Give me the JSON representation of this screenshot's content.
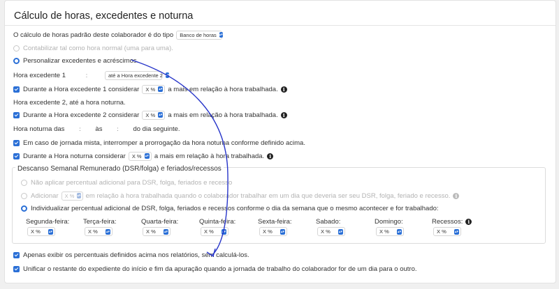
{
  "section": {
    "title": "Cálculo de horas, excedentes e noturna"
  },
  "standard": {
    "label": "O cálculo de horas padrão deste colaborador é do tipo",
    "select_value": "Banco de horas"
  },
  "options": {
    "normal_label": "Contabilizar tal como hora normal (uma para uma).",
    "custom_label": "Personalizar excedentes e acréscimos."
  },
  "he1": {
    "label": "Hora excedente 1",
    "time_value": ":",
    "range_value": "até a Hora excedente 2",
    "consider_prefix": "Durante a Hora excedente 1 considerar",
    "percent_value": "X %",
    "consider_suffix": "a mais em relação à hora trabalhada."
  },
  "he2": {
    "label": "Hora excedente 2, até a hora noturna.",
    "consider_prefix": "Durante a Hora excedente 2 considerar",
    "percent_value": "X %",
    "consider_suffix": "a mais em relação à hora trabalhada."
  },
  "night": {
    "label_from": "Hora noturna das",
    "from_value": ":",
    "label_to": "às",
    "to_value": ":",
    "label_next": "do dia seguinte.",
    "mixed_label": "Em caso de jornada mista, interromper a prorrogação da hora noturna conforme definido acima.",
    "consider_prefix": "Durante a Hora noturna considerar",
    "percent_value": "X %",
    "consider_suffix": "a mais em relação à hora trabalhada."
  },
  "dsr": {
    "legend": "Descanso Semanal Remunerado (DSR/folga) e feriados/recessos",
    "opt_none": "Não aplicar percentual adicional para DSR, folga, feriados e recesso",
    "opt_add_prefix": "Adicionar",
    "opt_add_value": "X %",
    "opt_add_suffix": "em relação à hora trabalhada quando o colaborador trabalhar em um dia que deveria ser seu DSR, folga, feriado e recesso.",
    "opt_individual": "Individualizar percentual adicional de DSR, folga, feriados e recessos conforme o dia da semana que o mesmo acontecer e for trabalhado:",
    "days": [
      {
        "label": "Segunda-feira:",
        "value": "X %"
      },
      {
        "label": "Terça-feira:",
        "value": "X %"
      },
      {
        "label": "Quarta-feira:",
        "value": "X %"
      },
      {
        "label": "Quinta-feira:",
        "value": "X %"
      },
      {
        "label": "Sexta-feira:",
        "value": "X %"
      },
      {
        "label": "Sabado:",
        "value": "X %"
      },
      {
        "label": "Domingo:",
        "value": "X %"
      },
      {
        "label": "Recessos:",
        "value": "X %"
      }
    ]
  },
  "bottom": {
    "only_show": "Apenas exibir os percentuais definidos acima nos relatórios, sem calculá-los.",
    "unify": "Unificar o restante do expediente do início e fim da apuração quando a jornada de trabalho do colaborador for de um dia para o outro."
  },
  "icons": {
    "select_arrow": "chevron-up-down-icon",
    "info": "info-icon",
    "annotation": "curved-arrow-annotation"
  },
  "colors": {
    "accent": "#2a6fd6",
    "annotation": "#2634c9"
  }
}
